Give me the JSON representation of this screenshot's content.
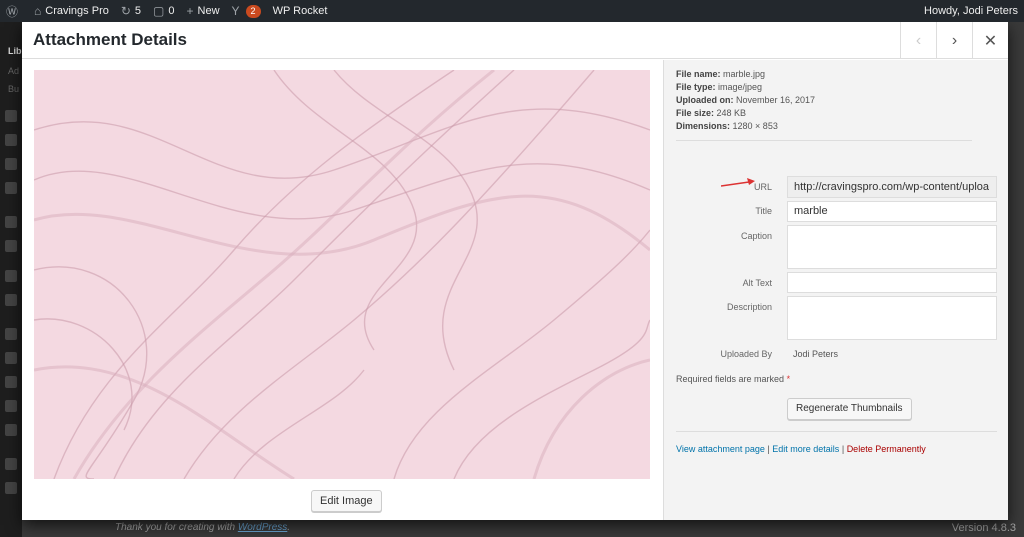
{
  "admin_bar": {
    "site_name": "Cravings Pro",
    "updates_count": "5",
    "comments_count": "0",
    "new_label": "New",
    "yoast_badge": "2",
    "wp_rocket_label": "WP Rocket",
    "greeting": "Howdy, Jodi Peters"
  },
  "sidebar": {
    "items": [
      "Lib",
      "Ad",
      "Bu"
    ]
  },
  "modal": {
    "title": "Attachment Details",
    "prev_icon": "chevron-left-icon",
    "next_icon": "chevron-right-icon",
    "close_icon": "close-icon"
  },
  "image": {
    "edit_button": "Edit Image",
    "base_color": "#f4d9e1",
    "vein_color": "#c898a8"
  },
  "meta": {
    "file_name_label": "File name:",
    "file_name": "marble.jpg",
    "file_type_label": "File type:",
    "file_type": "image/jpeg",
    "uploaded_on_label": "Uploaded on:",
    "uploaded_on": "November 16, 2017",
    "file_size_label": "File size:",
    "file_size": "248 KB",
    "dimensions_label": "Dimensions:",
    "dimensions": "1280 × 853"
  },
  "fields": {
    "url_label": "URL",
    "url_value": "http://cravingspro.com/wp-content/uploa",
    "title_label": "Title",
    "title_value": "marble",
    "caption_label": "Caption",
    "caption_value": "",
    "alt_label": "Alt Text",
    "alt_value": "",
    "description_label": "Description",
    "description_value": "",
    "uploaded_by_label": "Uploaded By",
    "uploaded_by_value": "Jodi Peters"
  },
  "required_text": "Required fields are marked",
  "required_star": "*",
  "regenerate_button": "Regenerate Thumbnails",
  "actions": {
    "view": "View attachment page",
    "sep": "|",
    "edit": "Edit more details",
    "delete": "Delete Permanently"
  },
  "footer": {
    "text": "Thank you for creating with",
    "link": "WordPress",
    "period": ".",
    "version": "Version 4.8.3"
  },
  "colors": {
    "link": "#0073aa",
    "delete": "#a00",
    "arrow": "#dc3232"
  }
}
